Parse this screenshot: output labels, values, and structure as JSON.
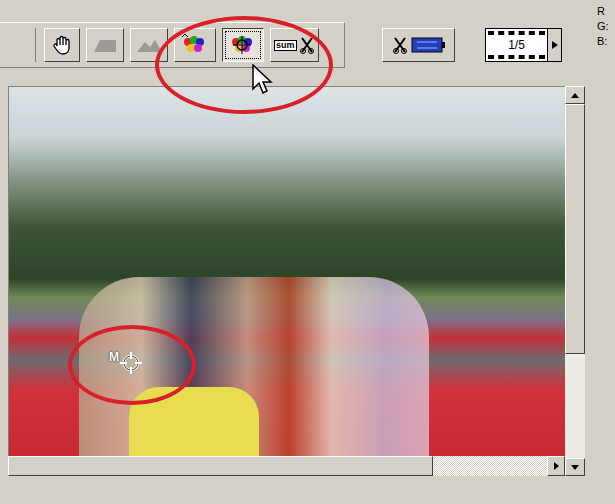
{
  "toolbar": {
    "buttons": [
      {
        "kind": "hand",
        "selected": false,
        "disabled": false
      },
      {
        "kind": "crop",
        "selected": false,
        "disabled": true
      },
      {
        "kind": "zoom",
        "selected": false,
        "disabled": true
      },
      {
        "kind": "white-point",
        "selected": false,
        "disabled": false
      },
      {
        "kind": "color-picker",
        "selected": true,
        "disabled": false
      },
      {
        "kind": "auto",
        "label": "sum",
        "selected": false,
        "disabled": false
      }
    ]
  },
  "frame_counter": {
    "text": "1/5"
  },
  "readout": [
    "R",
    "G:",
    "B:"
  ],
  "marker": {
    "label": "M"
  }
}
